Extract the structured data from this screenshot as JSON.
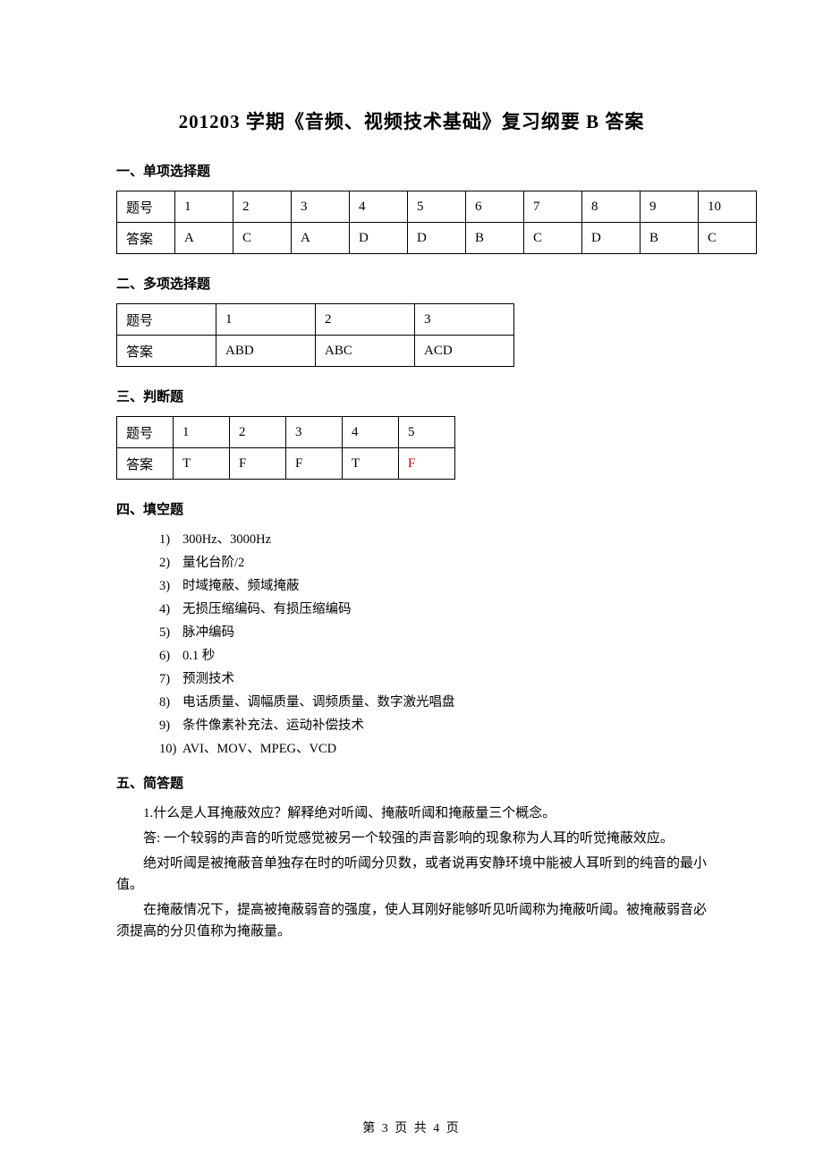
{
  "title": "201203 学期《音频、视频技术基础》复习纲要 B 答案",
  "sections": {
    "single": {
      "heading": "一、单项选择题",
      "row_label": "题号",
      "ans_label": "答案",
      "nums": [
        "1",
        "2",
        "3",
        "4",
        "5",
        "6",
        "7",
        "8",
        "9",
        "10"
      ],
      "answers": [
        "A",
        "C",
        "A",
        "D",
        "D",
        "B",
        "C",
        "D",
        "B",
        "C"
      ]
    },
    "multi": {
      "heading": "二、多项选择题",
      "row_label": "题号",
      "ans_label": "答案",
      "nums": [
        "1",
        "2",
        "3"
      ],
      "answers": [
        "ABD",
        "ABC",
        "ACD"
      ]
    },
    "judge": {
      "heading": "三、判断题",
      "row_label": "题号",
      "ans_label": "答案",
      "nums": [
        "1",
        "2",
        "3",
        "4",
        "5"
      ],
      "answers": [
        "T",
        "F",
        "F",
        "T",
        "F"
      ],
      "red_index": 4
    },
    "fill": {
      "heading": "四、填空题",
      "items": [
        "300Hz、3000Hz",
        "量化台阶/2",
        "时域掩蔽、频域掩蔽",
        "无损压缩编码、有损压缩编码",
        "脉冲编码",
        "0.1 秒",
        "预测技术",
        "电话质量、调幅质量、调频质量、数字激光唱盘",
        "条件像素补充法、运动补偿技术",
        "AVI、MOV、MPEG、VCD"
      ]
    },
    "essay": {
      "heading": "五、简答题",
      "q1": "1.什么是人耳掩蔽效应？解释绝对听阈、掩蔽听阈和掩蔽量三个概念。",
      "a1_p1": "答: 一个较弱的声音的听觉感觉被另一个较强的声音影响的现象称为人耳的听觉掩蔽效应。",
      "a1_p2": "绝对听阈是被掩蔽音单独存在时的听阈分贝数，或者说再安静环境中能被人耳听到的纯音的最小值。",
      "a1_p3": "在掩蔽情况下，提高被掩蔽弱音的强度，使人耳刚好能够听见听阈称为掩蔽听阈。被掩蔽弱音必须提高的分贝值称为掩蔽量。"
    }
  },
  "footer": "第 3 页 共 4 页"
}
